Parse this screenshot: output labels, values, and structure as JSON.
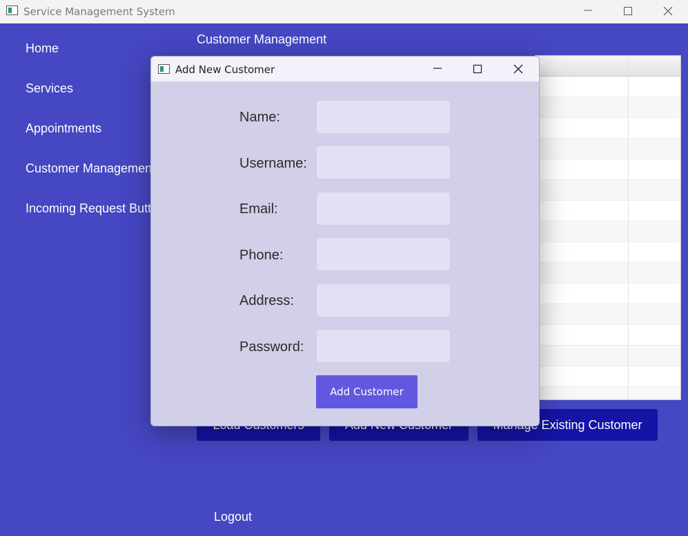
{
  "window": {
    "title": "Service Management System",
    "controls": [
      "minimize-icon",
      "maximize-icon",
      "close-icon"
    ]
  },
  "sidebar": {
    "items": [
      {
        "label": "Home"
      },
      {
        "label": "Services"
      },
      {
        "label": "Appointments"
      },
      {
        "label": "Customer Management"
      },
      {
        "label": "Incoming Request Button"
      }
    ],
    "logout_label": "Logout"
  },
  "main": {
    "section_title": "Customer Management",
    "buttons": [
      {
        "label": "Load Customers"
      },
      {
        "label": "Add New Customer"
      },
      {
        "label": "Manage Existing Customer"
      }
    ]
  },
  "dialog": {
    "title": "Add New Customer",
    "fields": [
      {
        "label": "Name:",
        "value": "",
        "placeholder": ""
      },
      {
        "label": "Username:",
        "value": "",
        "placeholder": ""
      },
      {
        "label": "Email:",
        "value": "",
        "placeholder": ""
      },
      {
        "label": "Phone:",
        "value": "",
        "placeholder": ""
      },
      {
        "label": "Address:",
        "value": "",
        "placeholder": ""
      },
      {
        "label": "Password:",
        "value": "",
        "placeholder": ""
      }
    ],
    "submit_label": "Add Customer"
  },
  "colors": {
    "background": "#4647c2",
    "dialog_background": "#d1d0e8",
    "main_button": "#1414a6",
    "accent_button": "#6258df"
  }
}
